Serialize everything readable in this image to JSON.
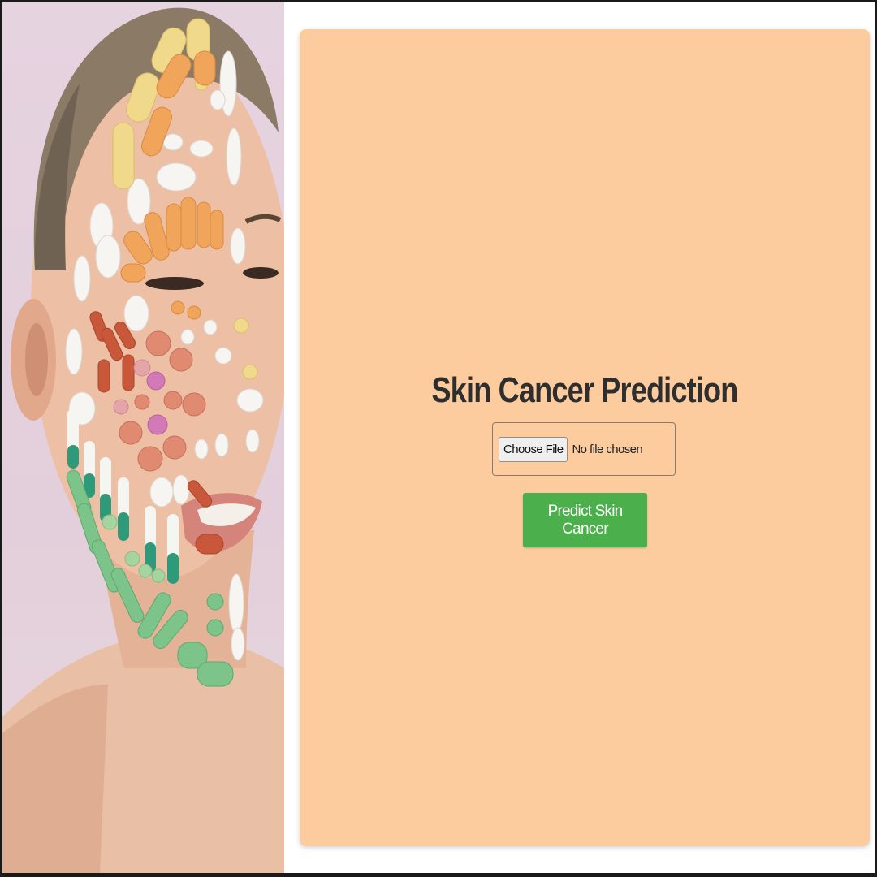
{
  "hero": {
    "image_name": "portrait-with-pills-illustration"
  },
  "card": {
    "title": "Skin Cancer Prediction",
    "file_input": {
      "button_label": "Choose File",
      "status_text": "No file chosen"
    },
    "submit_label": "Predict Skin Cancer"
  },
  "colors": {
    "card_background": "#fdcc9e",
    "submit_background": "#4bb04b",
    "title_color": "#2e2e2e",
    "page_background": "#ffffff"
  }
}
